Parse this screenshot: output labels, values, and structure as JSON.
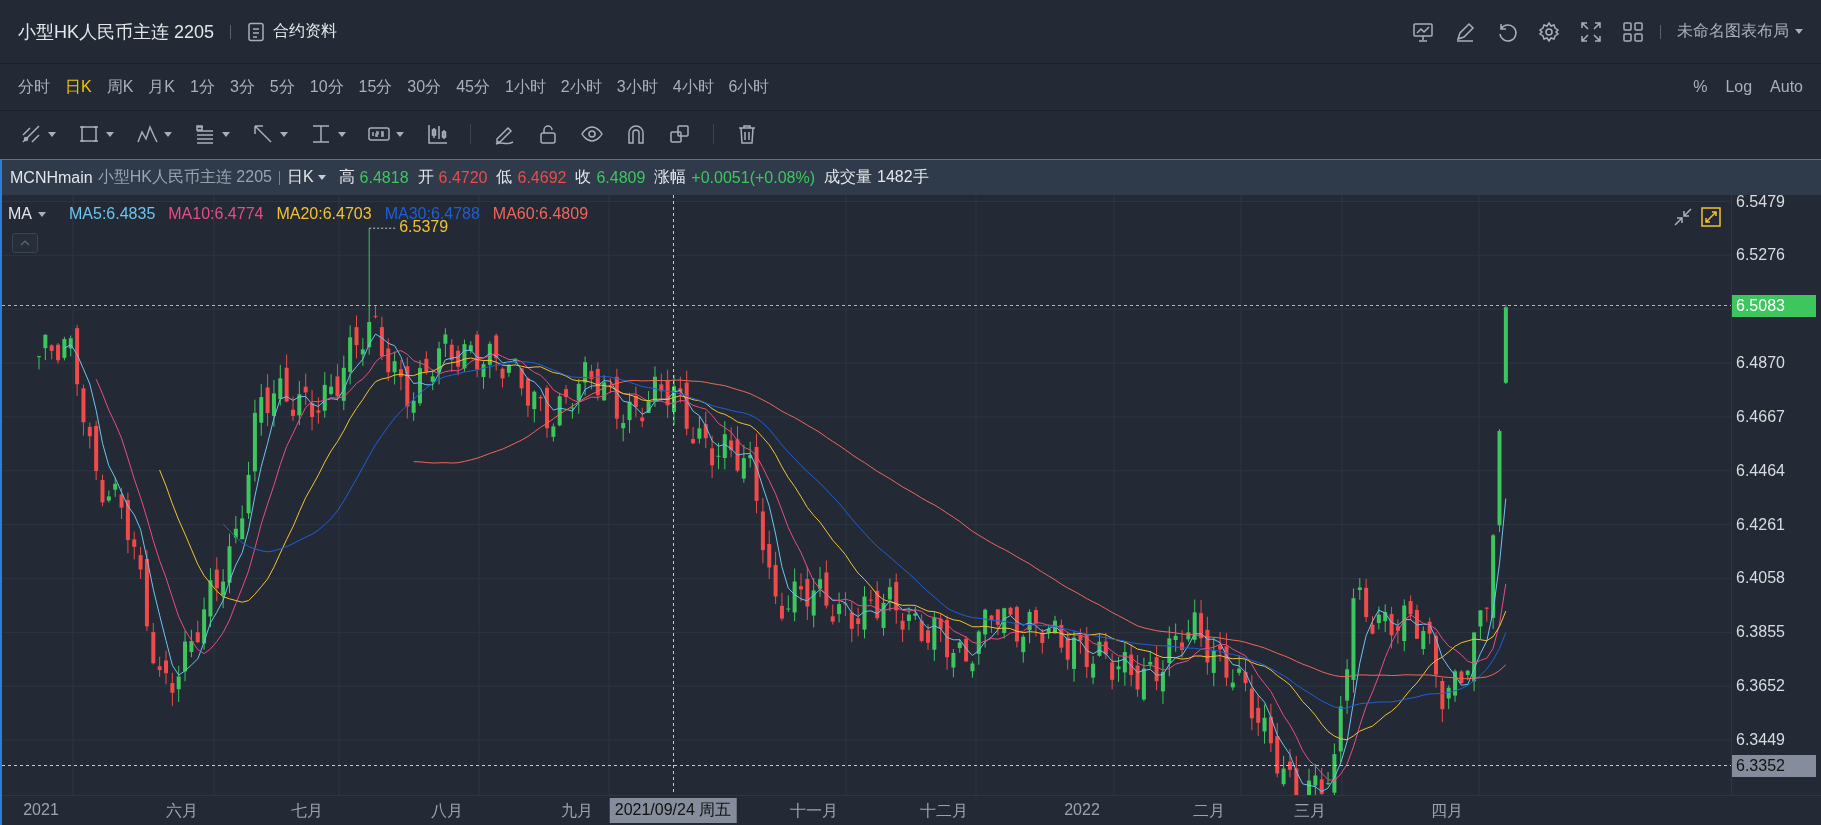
{
  "header": {
    "title": "小型HK人民币主连 2205",
    "contract_button": "合约资料",
    "layout_menu": "未命名图表布局"
  },
  "timeframes": [
    {
      "label": "分时",
      "selected": false
    },
    {
      "label": "日K",
      "selected": true
    },
    {
      "label": "周K",
      "selected": false
    },
    {
      "label": "月K",
      "selected": false
    },
    {
      "label": "1分",
      "selected": false
    },
    {
      "label": "3分",
      "selected": false
    },
    {
      "label": "5分",
      "selected": false
    },
    {
      "label": "10分",
      "selected": false
    },
    {
      "label": "15分",
      "selected": false
    },
    {
      "label": "30分",
      "selected": false
    },
    {
      "label": "45分",
      "selected": false
    },
    {
      "label": "1小时",
      "selected": false
    },
    {
      "label": "2小时",
      "selected": false
    },
    {
      "label": "3小时",
      "selected": false
    },
    {
      "label": "4小时",
      "selected": false
    },
    {
      "label": "6小时",
      "selected": false
    }
  ],
  "scale_options": [
    "%",
    "Log",
    "Auto"
  ],
  "info_bar": {
    "symbol": "MCNHmain",
    "name": "小型HK人民币主连 2205",
    "period": "日K",
    "fields": [
      {
        "label": "高",
        "value": "6.4818",
        "color": "#3ec65e"
      },
      {
        "label": "开",
        "value": "6.4720",
        "color": "#f04a4a"
      },
      {
        "label": "低",
        "value": "6.4692",
        "color": "#f04a4a"
      },
      {
        "label": "收",
        "value": "6.4809",
        "color": "#3ec65e"
      },
      {
        "label": "涨幅",
        "value": "+0.0051(+0.08%)",
        "color": "#3ec65e"
      },
      {
        "label": "成交量",
        "value": "1482手",
        "color": "#e4e6ea"
      }
    ]
  },
  "ma_legend": {
    "label": "MA",
    "items": [
      {
        "label": "MA5:6.4835",
        "color": "#6cc4f0"
      },
      {
        "label": "MA10:6.4774",
        "color": "#e84c86"
      },
      {
        "label": "MA20:6.4703",
        "color": "#f2c232"
      },
      {
        "label": "MA30:6.4788",
        "color": "#1f5fd6"
      },
      {
        "label": "MA60:6.4809",
        "color": "#f0665a"
      }
    ]
  },
  "chart": {
    "high_marker": "6.5379",
    "last_price": "6.5083",
    "crosshair_price": "6.3352",
    "crosshair_date": "2021/09/24 周五",
    "price_axis": [
      "6.5479",
      "6.5276",
      "6.4870",
      "6.4667",
      "6.4464",
      "6.4261",
      "6.4058",
      "6.3855",
      "6.3652",
      "6.3449"
    ],
    "time_axis": [
      "2021",
      "六月",
      "七月",
      "八月",
      "九月",
      "十一月",
      "十二月",
      "2022",
      "二月",
      "三月",
      "四月"
    ]
  }
}
